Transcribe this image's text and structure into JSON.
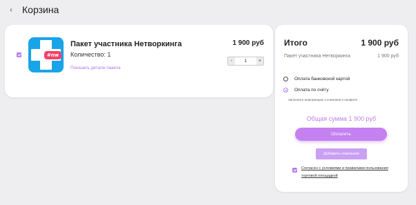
{
  "header": {
    "title": "Корзина",
    "back_icon": "chevron-left-icon"
  },
  "cart": {
    "item": {
      "selected": true,
      "logo_text": "#nw",
      "logo_color": "#1aa4e8",
      "logo_badge_color": "#f3416a",
      "title": "Пакет участника Нетворкинга",
      "quantity_text": "Количество: 1",
      "details_link": "Показать детали пакета",
      "price": "1 900 руб",
      "stepper": {
        "minus": "-",
        "value": "1",
        "plus": "+"
      }
    }
  },
  "summary": {
    "title": "Итого",
    "price": "1 900 руб",
    "item_name": "Пакет участника Нетворкинга",
    "item_price": "1 900 руб",
    "payment_options": [
      {
        "label": "Оплата банковской картой",
        "selected": false
      },
      {
        "label": "Оплата по счёту",
        "selected": true
      }
    ],
    "note": "Заполните информацию о компании в профиле",
    "total_text": "Общая сумма 1 900 руб",
    "pay_button": "Оплатить",
    "add_company_button": "Добавить компанию",
    "agree_checked": true,
    "agree_text": "Согласен с условиями и правилами пользования торговой площадкой"
  },
  "colors": {
    "accent": "#b47ef0",
    "pay_button": "#c581f0",
    "total_text": "#c080ea"
  }
}
